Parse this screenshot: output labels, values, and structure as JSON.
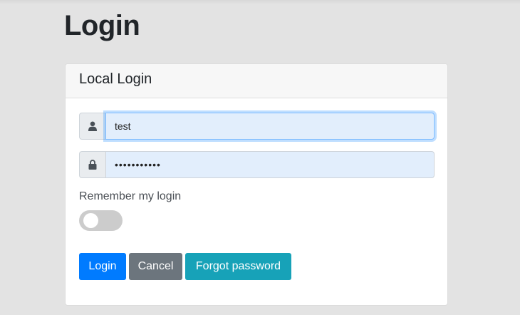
{
  "page": {
    "title": "Login"
  },
  "card": {
    "header": "Local Login"
  },
  "username": {
    "value": "test",
    "icon": "user-icon"
  },
  "password": {
    "value": "•••••••••••",
    "icon": "lock-icon"
  },
  "remember": {
    "label": "Remember my login",
    "checked": false
  },
  "buttons": {
    "login": "Login",
    "cancel": "Cancel",
    "forgot": "Forgot password"
  },
  "colors": {
    "primary": "#007bff",
    "secondary": "#6c757d",
    "info": "#17a2b8",
    "input_autofill": "#e2eefc"
  }
}
